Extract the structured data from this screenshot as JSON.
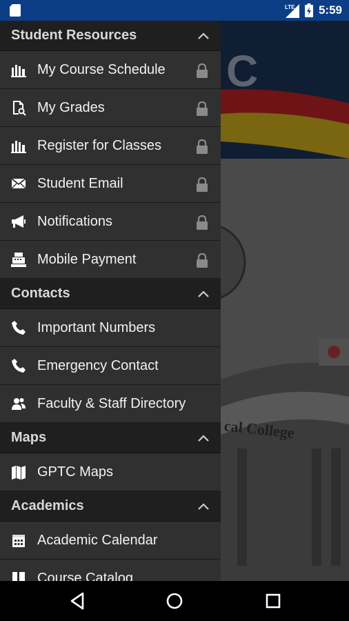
{
  "status_bar": {
    "time": "5:59",
    "network": "LTE"
  },
  "background_text": {
    "college": "cal College",
    "letter": "C"
  },
  "sections": [
    {
      "title": "Student Resources",
      "items": [
        {
          "label": "My Course Schedule",
          "icon": "building-icon",
          "locked": true
        },
        {
          "label": "My Grades",
          "icon": "grades-icon",
          "locked": true
        },
        {
          "label": "Register for Classes",
          "icon": "building-icon",
          "locked": true
        },
        {
          "label": "Student Email",
          "icon": "envelope-icon",
          "locked": true
        },
        {
          "label": "Notifications",
          "icon": "megaphone-icon",
          "locked": true
        },
        {
          "label": "Mobile Payment",
          "icon": "cash-register-icon",
          "locked": true
        }
      ]
    },
    {
      "title": "Contacts",
      "items": [
        {
          "label": "Important Numbers",
          "icon": "phone-icon",
          "locked": false
        },
        {
          "label": "Emergency Contact",
          "icon": "phone-icon",
          "locked": false
        },
        {
          "label": "Faculty & Staff Directory",
          "icon": "people-icon",
          "locked": false
        }
      ]
    },
    {
      "title": "Maps",
      "items": [
        {
          "label": "GPTC Maps",
          "icon": "map-icon",
          "locked": false
        }
      ]
    },
    {
      "title": "Academics",
      "items": [
        {
          "label": "Academic Calendar",
          "icon": "calendar-icon",
          "locked": false
        },
        {
          "label": "Course Catalog",
          "icon": "book-icon",
          "locked": false
        }
      ]
    }
  ],
  "colors": {
    "status_bar": "#0c3e86",
    "header": "#1f1f1f",
    "item": "#303030"
  }
}
